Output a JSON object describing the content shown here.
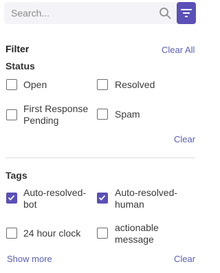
{
  "search": {
    "placeholder": "Search...",
    "value": ""
  },
  "filter": {
    "title": "Filter",
    "clear_all": "Clear All"
  },
  "status": {
    "title": "Status",
    "clear": "Clear",
    "options": [
      {
        "label": "Open",
        "checked": false
      },
      {
        "label": "Resolved",
        "checked": false
      },
      {
        "label": "First Response Pending",
        "checked": false
      },
      {
        "label": "Spam",
        "checked": false
      }
    ]
  },
  "tags": {
    "title": "Tags",
    "show_more": "Show more",
    "clear": "Clear",
    "options": [
      {
        "label": "Auto-resolved-bot",
        "checked": true
      },
      {
        "label": "Auto-resolved-human",
        "checked": true
      },
      {
        "label": "24 hour clock",
        "checked": false
      },
      {
        "label": "actionable message",
        "checked": false
      }
    ]
  },
  "colors": {
    "accent": "#5b50b8",
    "link": "#5b5fb0",
    "divider": "#dcdcdc"
  }
}
